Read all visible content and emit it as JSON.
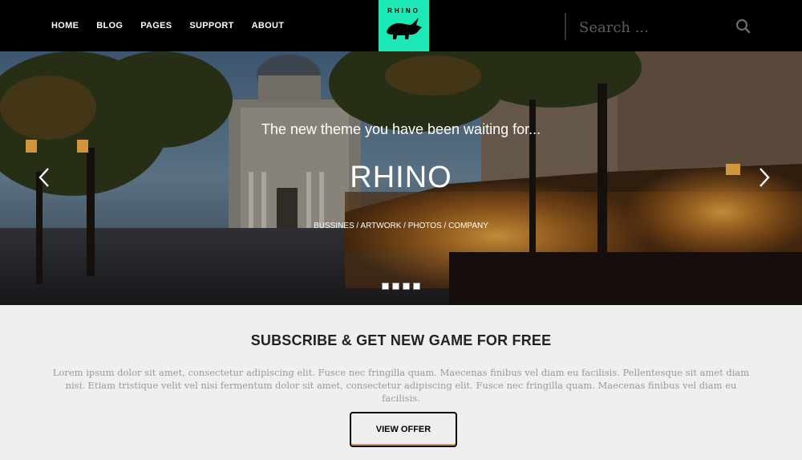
{
  "nav": {
    "items": [
      {
        "label": "HOME"
      },
      {
        "label": "BLOG"
      },
      {
        "label": "PAGES"
      },
      {
        "label": "SUPPORT"
      },
      {
        "label": "ABOUT"
      }
    ]
  },
  "logo": {
    "text": "RHINO",
    "icon": "rhino-icon",
    "color": "#1de9b6"
  },
  "search": {
    "placeholder": "Search ...",
    "icon": "search-icon"
  },
  "hero": {
    "subtitle": "The new theme you have been waiting for...",
    "title": "RHINO",
    "tags": "BUSSINES / ARTWORK / PHOTOS / COMPANY",
    "slide_count": 4,
    "prev_icon": "chevron-left-icon",
    "next_icon": "chevron-right-icon"
  },
  "subscribe": {
    "title": "SUBSCRIBE & GET NEW GAME FOR FREE",
    "text": "Lorem ipsum dolor sit amet, consectetur adipiscing elit. Fusce nec fringilla quam. Maecenas finibus vel diam eu facilisis. Pellentesque sit amet diam nisi. Etiam tristique velit vel nisi fermentum dolor sit amet, consectetur adipiscing elit. Fusce nec fringilla quam. Maecenas finibus vel diam eu facilisis.",
    "button_label": "VIEW OFFER"
  }
}
